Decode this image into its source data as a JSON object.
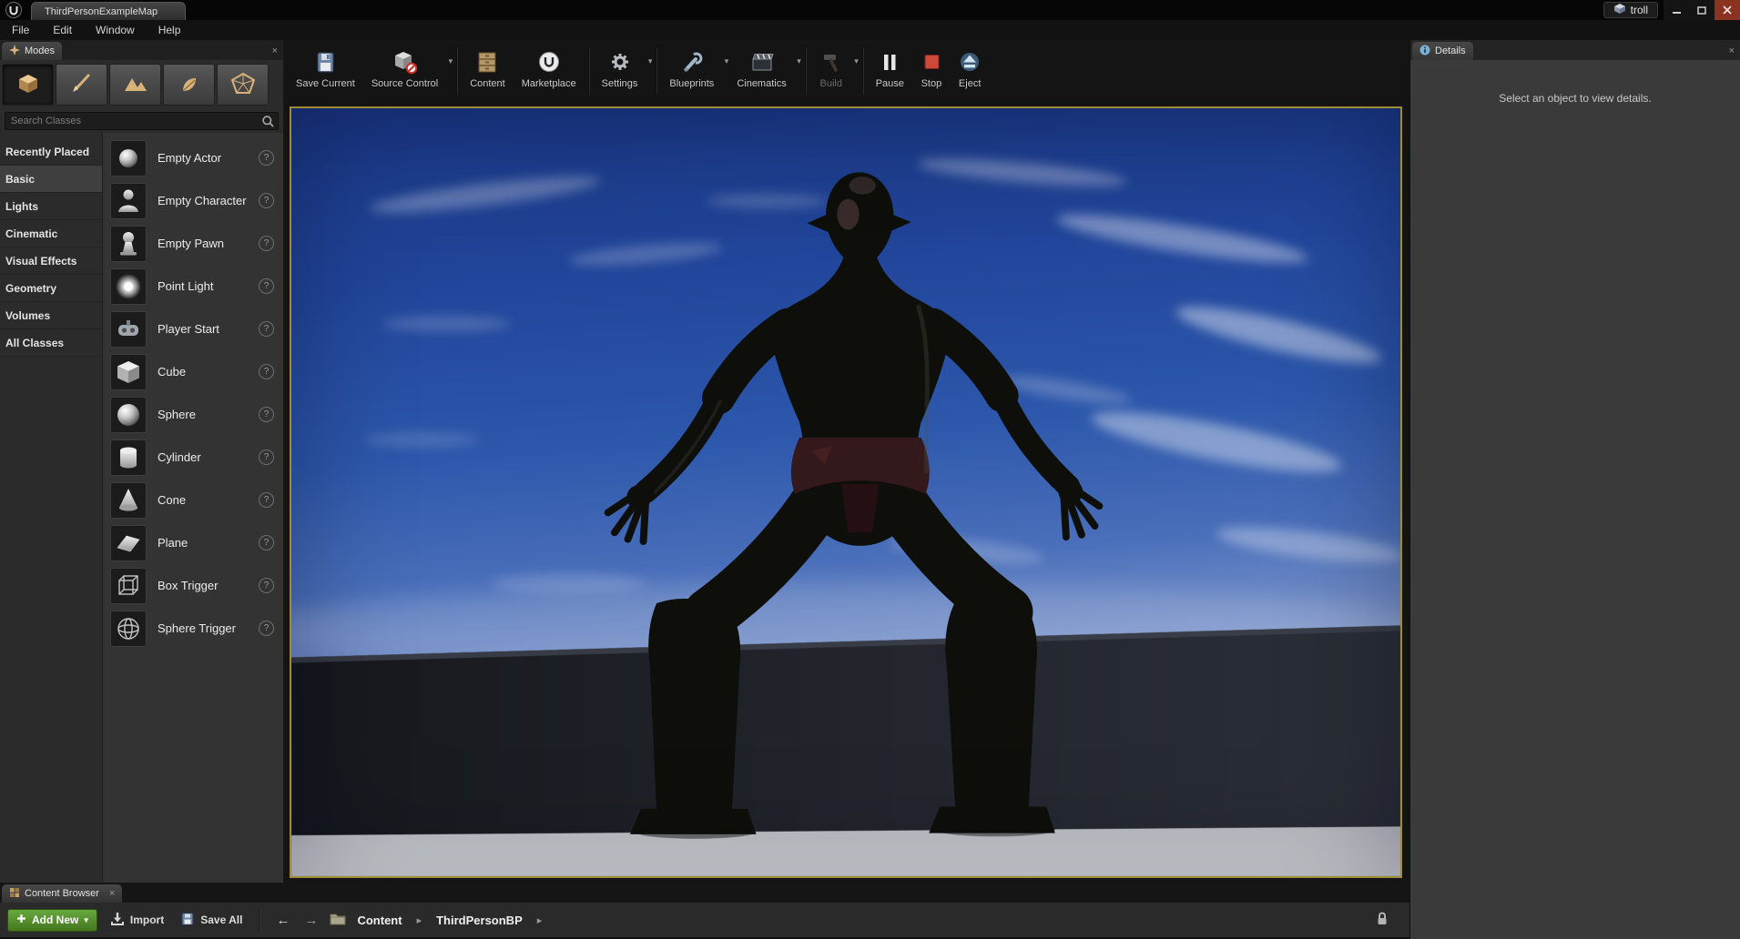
{
  "icons": {
    "dropdown": "▾",
    "grab": "?",
    "back": "←",
    "forward": "→",
    "crumb_sep": "▸",
    "close": "×"
  },
  "window": {
    "tab": "ThirdPersonExampleMap",
    "user": "troll"
  },
  "menubar": [
    "File",
    "Edit",
    "Window",
    "Help"
  ],
  "modes": {
    "tab": "Modes",
    "search_placeholder": "Search Classes",
    "categories": [
      "Recently Placed",
      "Basic",
      "Lights",
      "Cinematic",
      "Visual Effects",
      "Geometry",
      "Volumes",
      "All Classes"
    ],
    "selected_category": "Basic",
    "items": [
      "Empty Actor",
      "Empty Character",
      "Empty Pawn",
      "Point Light",
      "Player Start",
      "Cube",
      "Sphere",
      "Cylinder",
      "Cone",
      "Plane",
      "Box Trigger",
      "Sphere Trigger"
    ]
  },
  "toolbar": {
    "save_current": "Save Current",
    "source_control": "Source Control",
    "content": "Content",
    "marketplace": "Marketplace",
    "settings": "Settings",
    "blueprints": "Blueprints",
    "cinematics": "Cinematics",
    "build": "Build",
    "pause": "Pause",
    "stop": "Stop",
    "eject": "Eject"
  },
  "details": {
    "tab": "Details",
    "message": "Select an object to view details."
  },
  "content_browser": {
    "tab": "Content Browser",
    "add_new": "Add New",
    "import": "Import",
    "save_all": "Save All",
    "crumb_root": "Content",
    "crumb_folder": "ThirdPersonBP"
  }
}
